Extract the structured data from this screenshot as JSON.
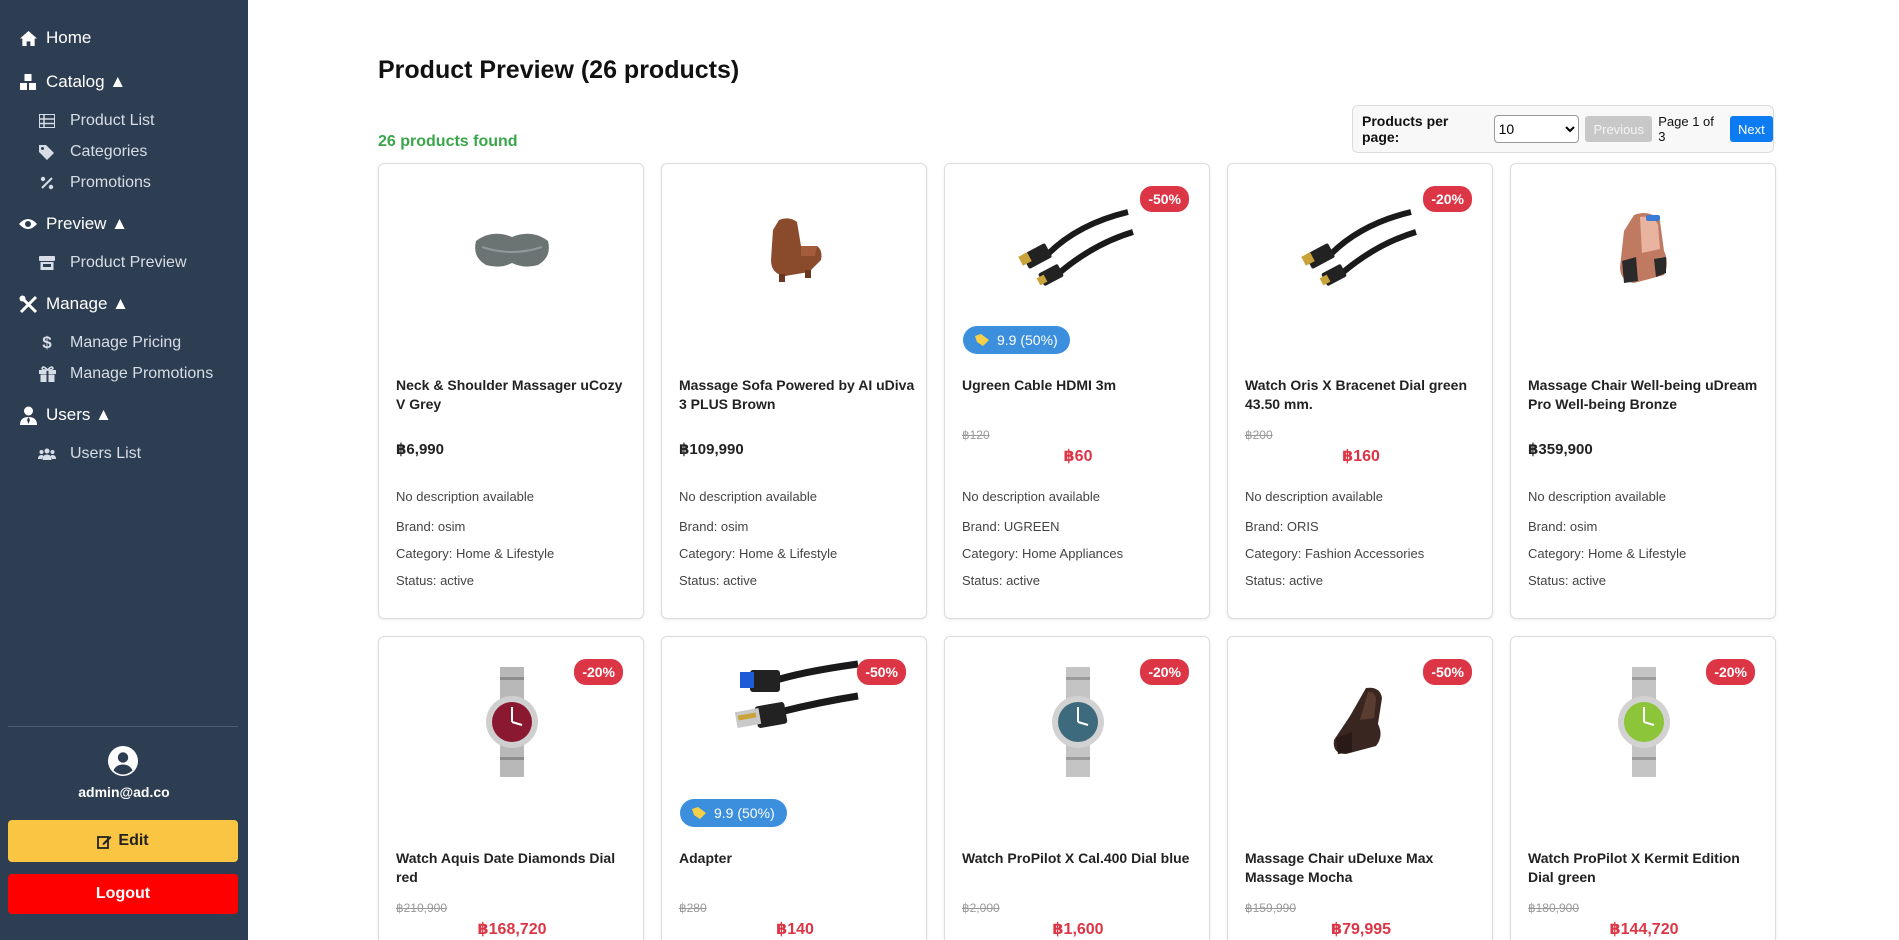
{
  "sidebar": {
    "home": "Home",
    "catalog": "Catalog ▲",
    "product_list": "Product List",
    "categories": "Categories",
    "promotions": "Promotions",
    "preview": "Preview ▲",
    "product_preview": "Product Preview",
    "manage": "Manage ▲",
    "manage_pricing": "Manage Pricing",
    "manage_promotions": "Manage Promotions",
    "users": "Users ▲",
    "users_list": "Users List",
    "user_email": "admin@ad.co",
    "edit_label": "Edit",
    "logout_label": "Logout"
  },
  "main": {
    "title": "Product Preview (26 products)",
    "found": "26 products found",
    "pager": {
      "per_page_label": "Products per page:",
      "per_page_value": "10",
      "previous": "Previous",
      "page_info": "Page 1 of 3",
      "next": "Next"
    }
  },
  "products": [
    {
      "name": "Neck & Shoulder Massager uCozy V Grey",
      "price": "฿6,990",
      "description": "No description available",
      "brand": "Brand: osim",
      "category": "Category: Home & Lifestyle",
      "status": "Status: active",
      "image": "neck-massager"
    },
    {
      "name": "Massage Sofa Powered by AI uDiva 3 PLUS Brown",
      "price": "฿109,990",
      "description": "No description available",
      "brand": "Brand: osim",
      "category": "Category: Home & Lifestyle",
      "status": "Status: active",
      "image": "massage-sofa"
    },
    {
      "name": "Ugreen Cable HDMI 3m",
      "old_price": "฿120",
      "sale_price": "฿60",
      "discount": "-50%",
      "promo": "9.9 (50%)",
      "description": "No description available",
      "brand": "Brand: UGREEN",
      "category": "Category: Home Appliances",
      "status": "Status: active",
      "image": "hdmi-cable"
    },
    {
      "name": "Watch Oris X Bracenet Dial green 43.50 mm.",
      "old_price": "฿200",
      "sale_price": "฿160",
      "discount": "-20%",
      "description": "No description available",
      "brand": "Brand: ORIS",
      "category": "Category: Fashion Accessories",
      "status": "Status: active",
      "image": "hdmi-cable"
    },
    {
      "name": "Massage Chair Well-being uDream Pro Well-being Bronze",
      "price": "฿359,900",
      "description": "No description available",
      "brand": "Brand: osim",
      "category": "Category: Home & Lifestyle",
      "status": "Status: active",
      "image": "massage-chair-bronze"
    },
    {
      "name": "Watch Aquis Date Diamonds Dial red",
      "old_price": "฿210,900",
      "sale_price": "฿168,720",
      "discount": "-20%",
      "image": "watch-red"
    },
    {
      "name": "Adapter",
      "old_price": "฿280",
      "sale_price": "฿140",
      "discount": "-50%",
      "promo": "9.9 (50%)",
      "image": "usb-adapter"
    },
    {
      "name": "Watch ProPilot X Cal.400 Dial blue",
      "old_price": "฿2,000",
      "sale_price": "฿1,600",
      "discount": "-20%",
      "image": "watch-blue"
    },
    {
      "name": "Massage Chair uDeluxe Max Massage Mocha",
      "old_price": "฿159,990",
      "sale_price": "฿79,995",
      "discount": "-50%",
      "image": "massage-chair-mocha"
    },
    {
      "name": "Watch ProPilot X Kermit Edition Dial green",
      "old_price": "฿180,900",
      "sale_price": "฿144,720",
      "discount": "-20%",
      "image": "watch-green"
    }
  ],
  "colors": {
    "sidebar_bg": "#2e3e52",
    "found_green": "#3aa64a",
    "discount_red": "#dc3545",
    "promo_blue": "#3b8fdc",
    "next_blue": "#0d7cf2",
    "edit_yellow": "#f9c543",
    "logout_red": "#ff0000"
  }
}
